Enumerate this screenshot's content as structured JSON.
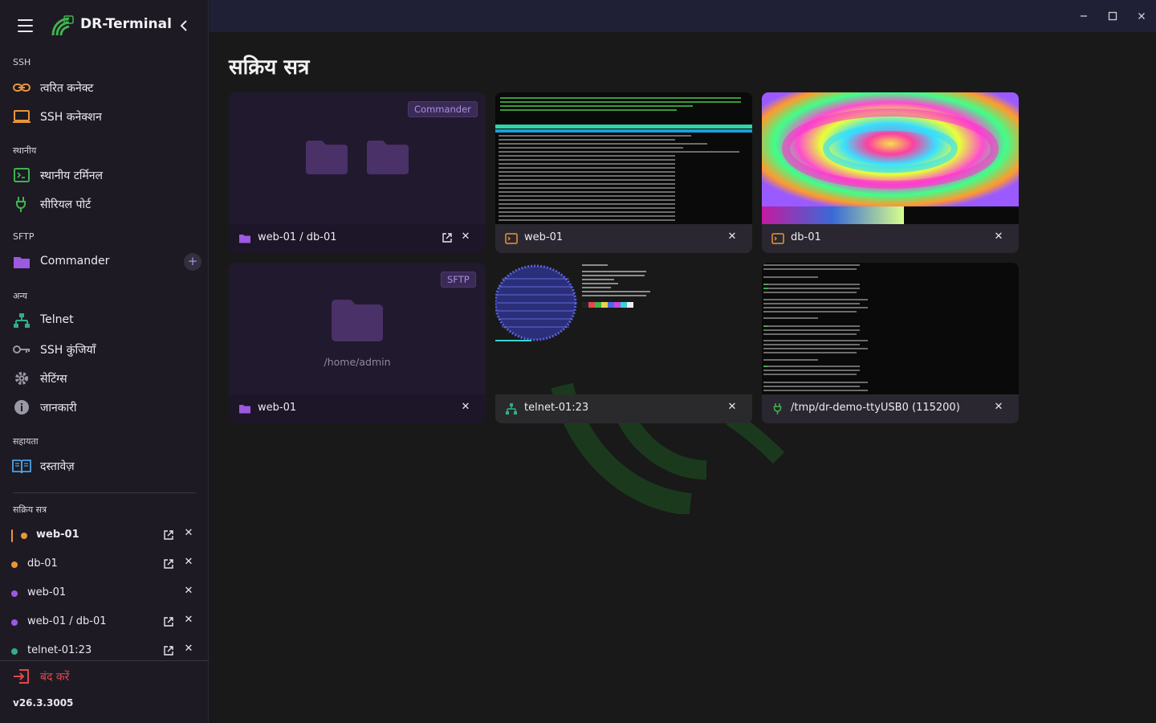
{
  "app": {
    "title": "DR-Terminal"
  },
  "sidebar": {
    "sections": {
      "ssh": "SSH",
      "local": "स्थानीय",
      "sftp": "SFTP",
      "other": "अन्य",
      "help": "सहायता",
      "active": "सक्रिय सत्र"
    },
    "items": {
      "quick_connect": "त्वरित कनेक्ट",
      "ssh_connections": "SSH कनेक्शन",
      "local_terminal": "स्थानीय टर्मिनल",
      "serial_port": "सीरियल पोर्ट",
      "commander": "Commander",
      "telnet": "Telnet",
      "ssh_keys": "SSH कुंजियाँ",
      "settings": "सेटिंग्स",
      "info": "जानकारी",
      "docs": "दस्तावेज़"
    },
    "sessions": [
      {
        "name": "web-01",
        "color": "#e8963a",
        "active": true
      },
      {
        "name": "db-01",
        "color": "#e8963a",
        "active": false
      },
      {
        "name": "web-01",
        "color": "#9b5ae0",
        "active": false
      },
      {
        "name": "web-01 / db-01",
        "color": "#9b5ae0",
        "active": false
      },
      {
        "name": "telnet-01:23",
        "color": "#2fae88",
        "active": false
      }
    ],
    "close_label": "बंद करें",
    "version": "v26.3.3005"
  },
  "main": {
    "title": "सक्रिय सत्र",
    "cards": [
      {
        "title": "web-01 / db-01",
        "badge": "Commander",
        "kind": "commander"
      },
      {
        "title": "web-01",
        "kind": "ssh-terminal"
      },
      {
        "title": "db-01",
        "kind": "ssh-terminal"
      },
      {
        "title": "web-01",
        "badge": "SFTP",
        "path": "/home/admin",
        "kind": "sftp"
      },
      {
        "title": "telnet-01:23",
        "kind": "telnet"
      },
      {
        "title": "/tmp/dr-demo-ttyUSB0 (115200)",
        "kind": "serial"
      }
    ]
  },
  "colors": {
    "accent_purple": "#9b5ae0",
    "ssh_orange": "#e8963a",
    "telnet_green": "#2fae88",
    "danger_red": "#e0494a"
  }
}
